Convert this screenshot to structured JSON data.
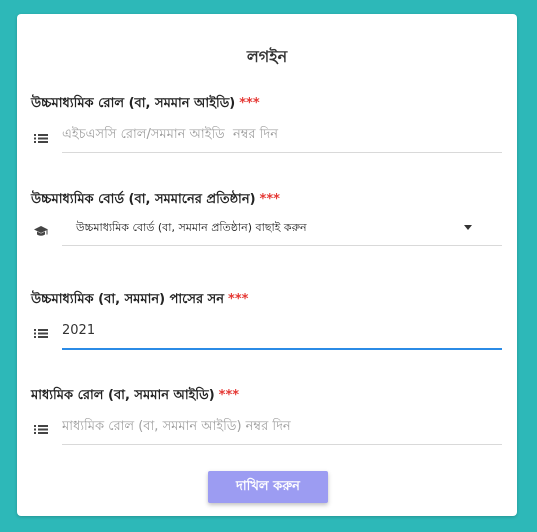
{
  "form": {
    "title": "লগইন",
    "required_mark": "***",
    "hsc_roll": {
      "label": "উচ্চমাধ্যমিক রোল (বা, সমমান আইডি)",
      "placeholder": "এইচএসসি রোল/সমমান আইডি  নম্বর দিন",
      "value": "",
      "icon": "list-icon"
    },
    "hsc_board": {
      "label": "উচ্চমাধ্যমিক বোর্ড (বা, সমমানের প্রতিষ্ঠান)",
      "selected": "উচ্চমাধ্যমিক বোর্ড (বা, সমমান প্রতিষ্ঠান) বাছাই করুন",
      "icon": "graduation-cap-icon"
    },
    "hsc_year": {
      "label": "উচ্চমাধ্যমিক (বা, সমমান) পাসের সন",
      "value": "2021",
      "icon": "list-icon"
    },
    "ssc_roll": {
      "label": "মাধ্যমিক রোল (বা, সমমান আইডি)",
      "placeholder": "মাধ্যমিক রোল (বা, সমমান আইডি) নম্বর দিন",
      "value": "",
      "icon": "list-icon"
    },
    "submit_label": "দাখিল করুন"
  },
  "colors": {
    "background": "#2db8b8",
    "card": "#ffffff",
    "required": "#e53935",
    "active_underline": "#2b8be6",
    "submit_button": "#9c9cf2"
  }
}
